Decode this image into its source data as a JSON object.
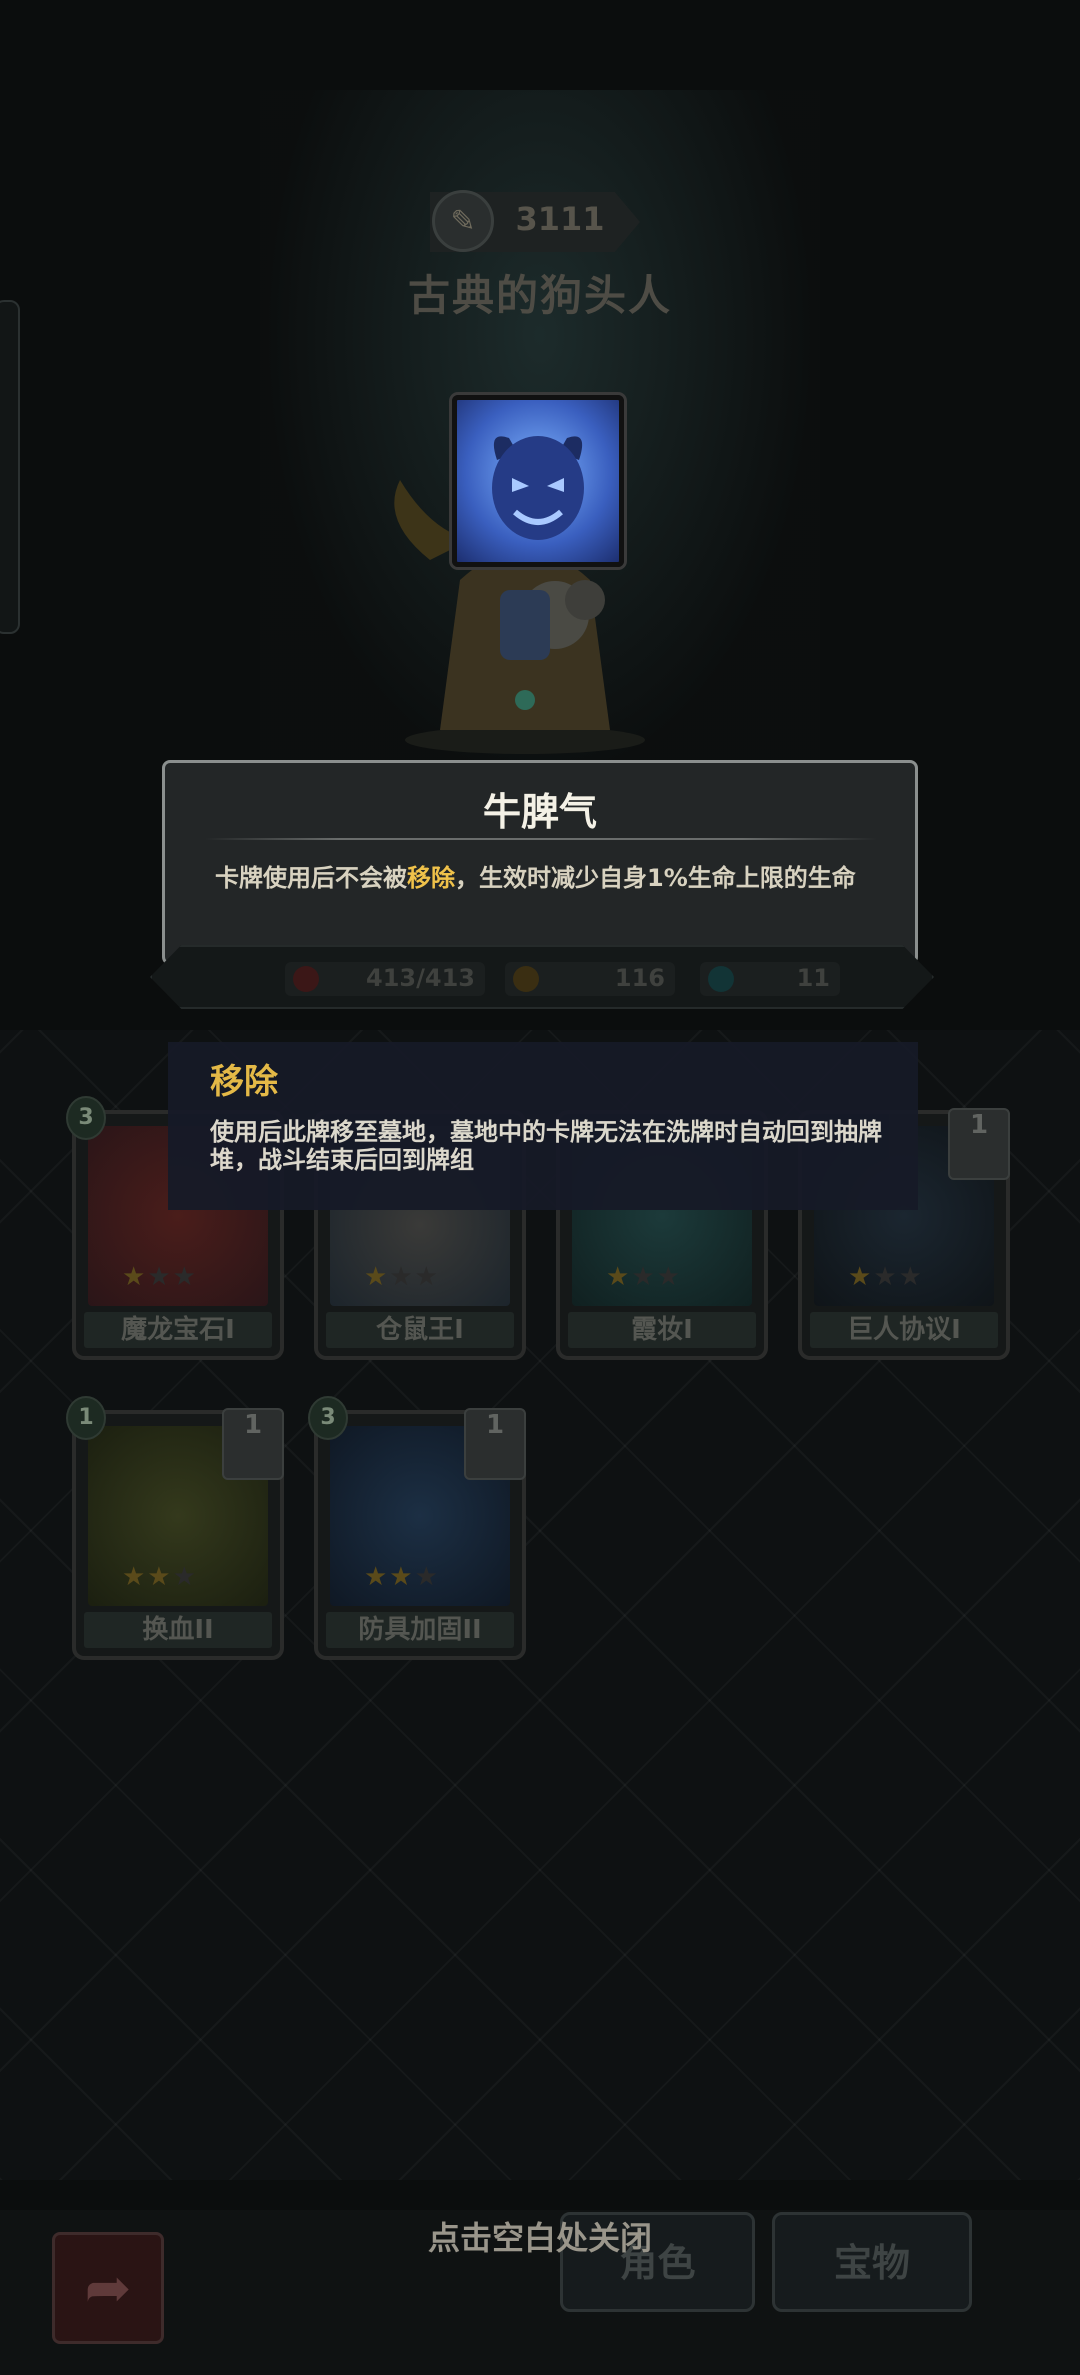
{
  "header": {
    "score": "3111",
    "score_icon": "quill-icon",
    "character_name": "古典的狗头人"
  },
  "card_detail": {
    "title": "牛脾气",
    "desc_part1": "卡牌使用后不会被",
    "desc_keyword": "移除",
    "desc_part2": "，生效时减少自身1%生命上限的生命"
  },
  "stats": {
    "hp": "413/413",
    "attack": "116",
    "energy": "11"
  },
  "keyword": {
    "title": "移除",
    "description": "使用后此牌移至墓地，墓地中的卡牌无法在洗牌时自动回到抽牌堆，战斗结束后回到牌组"
  },
  "cards": [
    {
      "name": "魔龙宝石I",
      "cost": "3",
      "stars": 1,
      "copies": ""
    },
    {
      "name": "仓鼠王I",
      "cost": "",
      "stars": 1,
      "copies": ""
    },
    {
      "name": "霞妆I",
      "cost": "",
      "stars": 1,
      "copies": ""
    },
    {
      "name": "巨人协议I",
      "cost": "",
      "stars": 1,
      "copies": "1"
    },
    {
      "name": "换血II",
      "cost": "1",
      "stars": 2,
      "copies": "1"
    },
    {
      "name": "防具加固II",
      "cost": "3",
      "stars": 2,
      "copies": "1"
    }
  ],
  "close_hint": "点击空白处关闭",
  "bottom_tabs": {
    "character": "角色",
    "treasure": "宝物"
  },
  "colors": {
    "accent_keyword": "#f0c24a",
    "tooltip_border": "#8b8f8e"
  }
}
